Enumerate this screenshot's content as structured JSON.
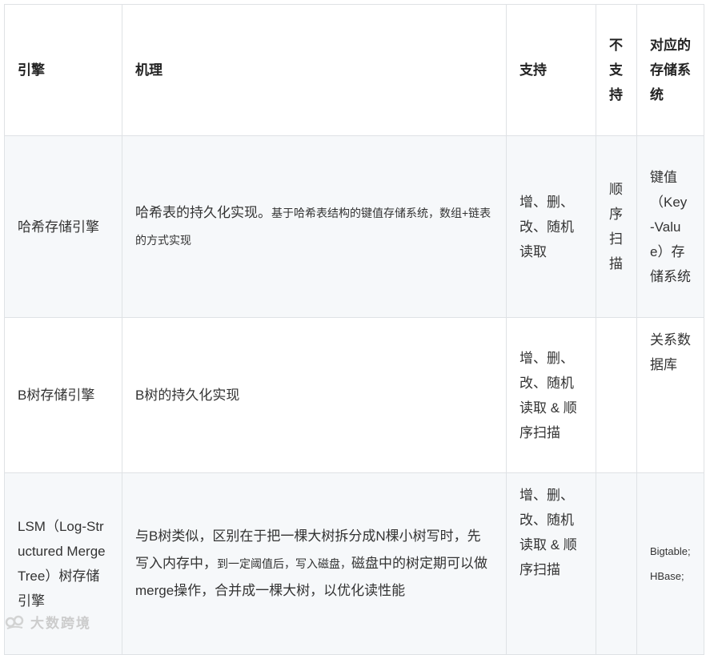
{
  "headers": {
    "engine": "引擎",
    "mechanism": "机理",
    "supports": "支持",
    "not_supports": "不支持",
    "storage_system": "对应的存储系统"
  },
  "rows": [
    {
      "engine": "哈希存储引擎",
      "mechanism_main": "哈希表的持久化实现。",
      "mechanism_detail": "基于哈希表结构的键值存储系统，数组+链表的方式实现",
      "supports": "增、删、改、随机读取",
      "not_supports": "顺序扫描",
      "storage_system": "键值（Key-Value）存储系统"
    },
    {
      "engine": "B树存储引擎",
      "mechanism_main": "B树的持久化实现",
      "supports": "增、删、改、随机读取 & 顺序扫描",
      "not_supports": "",
      "storage_system": "关系数据库"
    },
    {
      "engine": "LSM（Log-Structured Merge Tree）树存储引擎",
      "mechanism_p1": "与B树类似，区别在于把一棵大树拆分成N棵小树写时，先写入内存中，",
      "mechanism_p2": "到一定阈值后，写入磁盘，",
      "mechanism_p3": "磁盘中的树定期可以做merge操作，合并成一棵大树，以优化读性能",
      "supports": "增、删、改、随机读取 & 顺序扫描",
      "not_supports": "",
      "storage_system": "Bigtable; HBase;"
    }
  ],
  "watermark": "大数跨境"
}
